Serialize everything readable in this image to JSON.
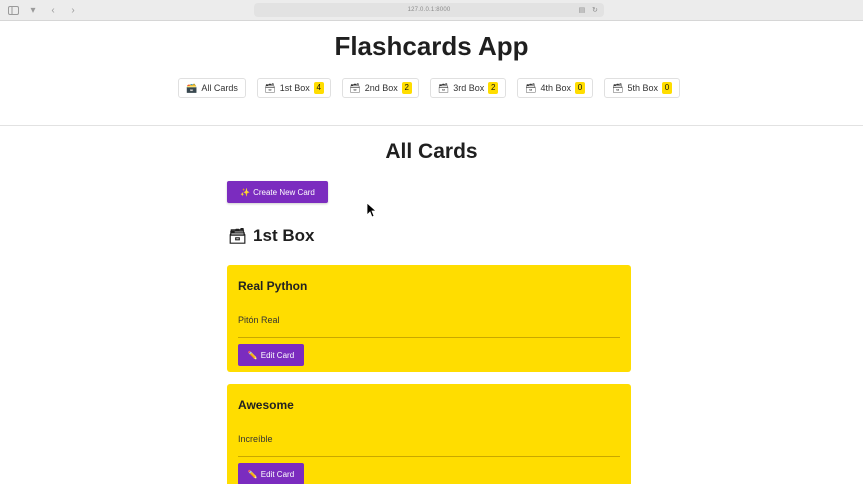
{
  "browser": {
    "url": "127.0.0.1:8000",
    "icons": [
      "sidebar-icon",
      "back-icon",
      "forward-icon",
      "translate-icon",
      "share-icon"
    ]
  },
  "header": {
    "title": "Flashcards App",
    "nav": [
      {
        "emoji": "🗃️",
        "label": "All Cards",
        "count": null
      },
      {
        "emoji": "🗃",
        "label": "1st Box",
        "count": "4"
      },
      {
        "emoji": "🗃",
        "label": "2nd Box",
        "count": "2"
      },
      {
        "emoji": "🗃",
        "label": "3rd Box",
        "count": "2"
      },
      {
        "emoji": "🗃",
        "label": "4th Box",
        "count": "0"
      },
      {
        "emoji": "🗃",
        "label": "5th Box",
        "count": "0"
      }
    ],
    "badge_color": "#ffdd00"
  },
  "main": {
    "page_title": "All Cards",
    "create_button": {
      "emoji": "✨",
      "label": "Create New Card"
    },
    "box_heading": {
      "emoji": "🗃",
      "label": "1st Box"
    },
    "cards": [
      {
        "question": "Real Python",
        "answer": "Pitón Real",
        "edit_emoji": "✏️",
        "edit_label": "Edit Card"
      },
      {
        "question": "Awesome",
        "answer": "Increíble",
        "edit_emoji": "✏️",
        "edit_label": "Edit Card"
      }
    ]
  },
  "colors": {
    "accent": "#7b2cbf",
    "card": "#ffdd00"
  }
}
